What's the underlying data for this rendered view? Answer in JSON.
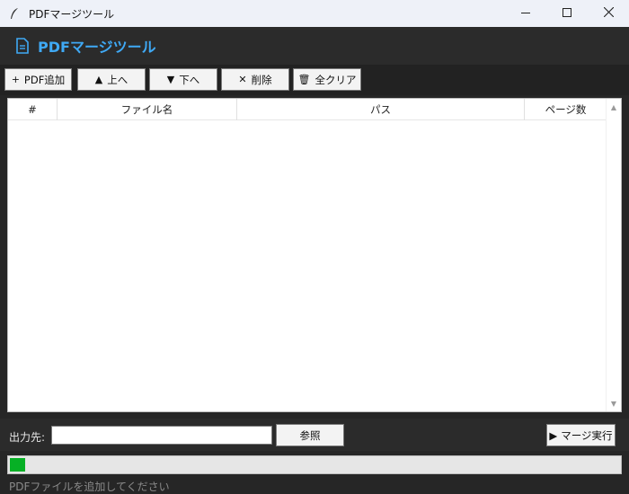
{
  "window": {
    "title": "PDFマージツール",
    "controls": {
      "minimize": "minimize-icon",
      "maximize": "maximize-icon",
      "close": "close-icon"
    }
  },
  "header": {
    "title": "PDFマージツール",
    "icon": "document-icon"
  },
  "toolbar": {
    "add": {
      "glyph": "+",
      "label": "PDF追加"
    },
    "up": {
      "glyph": "▲",
      "label": "上へ"
    },
    "down": {
      "glyph": "▼",
      "label": "下へ"
    },
    "delete": {
      "glyph": "✕",
      "label": "削除"
    },
    "clear": {
      "glyph": "🗑",
      "label": "全クリア"
    }
  },
  "table": {
    "columns": [
      "#",
      "ファイル名",
      "パス",
      "ページ数"
    ],
    "rows": []
  },
  "output": {
    "label": "出力先:",
    "path_value": "",
    "browse_label": "参照",
    "merge_glyph": "▶",
    "merge_label": "マージ実行"
  },
  "progress": {
    "value": 0.025,
    "color": "#06b025"
  },
  "status": "PDFファイルを追加してください",
  "colors": {
    "accent": "#3fa9f5",
    "background": "#262626"
  }
}
